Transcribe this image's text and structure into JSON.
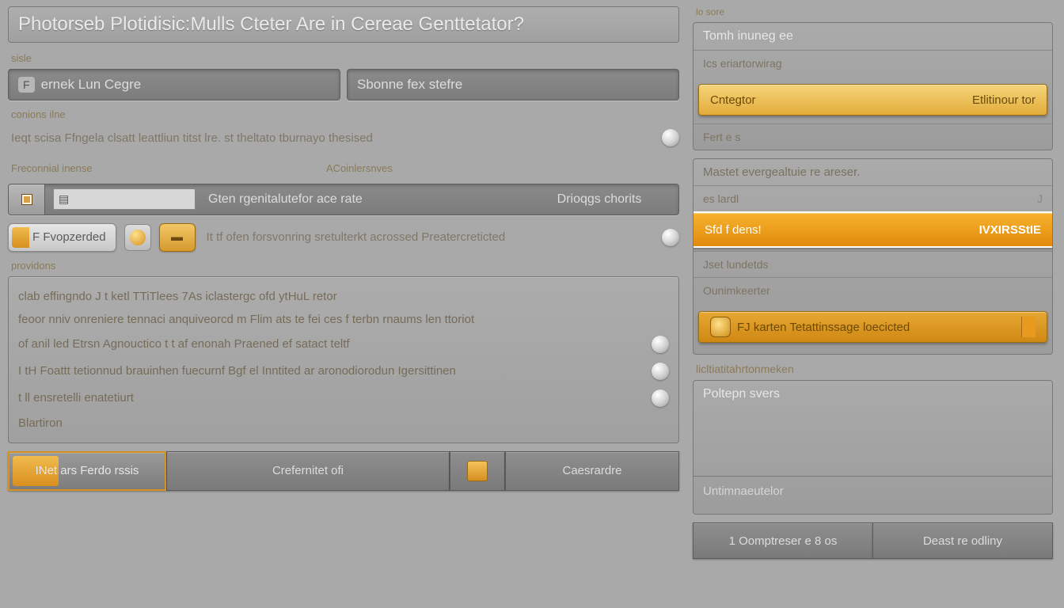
{
  "main": {
    "title": "Photorseb Plotidisic:Mulls Cteter Are in Cereae Genttetator?",
    "section_label": "sisle",
    "field1": {
      "tag": "F",
      "text": "ernek Lun Cegre"
    },
    "field2": {
      "text": "Sbonne fex stefre"
    },
    "options_label": "conions ilne",
    "options_desc": "Ieqt scisa Ffngela clsatt leattliun titst lre. st   theltato tburnayo thesised",
    "recom_left": "Freconnial inense",
    "recom_right": "ACoinlersnves",
    "selector": {
      "text": "Gten rgenitalutefor ace rate",
      "right": "Drioqgs chorits"
    },
    "pills": {
      "a": "F Fvopzerded  ",
      "b_alt": "gold disc",
      "c_alt": "gold pill",
      "desc": "It tf ofen forsvonring sretulterkt acrossed Preatercreticted"
    },
    "panel_header": "providons",
    "panel": {
      "l1": "clab effingndo J   t   ketl TTiTlees 7As iclastergc ofd ytHuL retor",
      "l2": "feoor nniv onreniere tennaci anquiveorcd m Flim ats te fei ces f terbn rnaums len ttoriot",
      "l3": "of   anil led Etrsn Agnouctico t           t af   enonah Praened ef satact teltf",
      "l4": "I tH Foattt     tetionnud brauinhen fuecurnf   Bgf el Inntited ar aronodiorodun Igersittinen",
      "l5": "t ll ensretelli enatetiurt",
      "l6": "Blartiron"
    },
    "bottom": {
      "primary": "INet ars Ferdo rssis",
      "generate": "Crefernitet ofi",
      "cancel": "Caesrardre"
    }
  },
  "sidebar": {
    "top_small": "lo sore",
    "p1": {
      "title": "Tomh inuneg ee",
      "row": "Ics eriartorwirag",
      "gold_left": "Cntegtor",
      "gold_right": "Etlitinour tor",
      "foot": "Fert e s"
    },
    "p2": {
      "title": "Mastet evergealtuie re areser.",
      "row1": "es lardl",
      "bright_left": "Sfd f dens!",
      "bright_right": "IVXIRSStIE",
      "row2": "Jset   lundetds",
      "row3": "Ounimkeerter",
      "gold2_left": "FJ   karten Tetattinssage loecicted"
    },
    "p3_title": "licltiatitahrtonmeken",
    "p4": {
      "title": "Poltepn svers",
      "input_label": "Untimnaeutelor"
    },
    "bottom": {
      "left": "1 Oomptreser e 8 os",
      "right": "Deast re odliny"
    }
  }
}
